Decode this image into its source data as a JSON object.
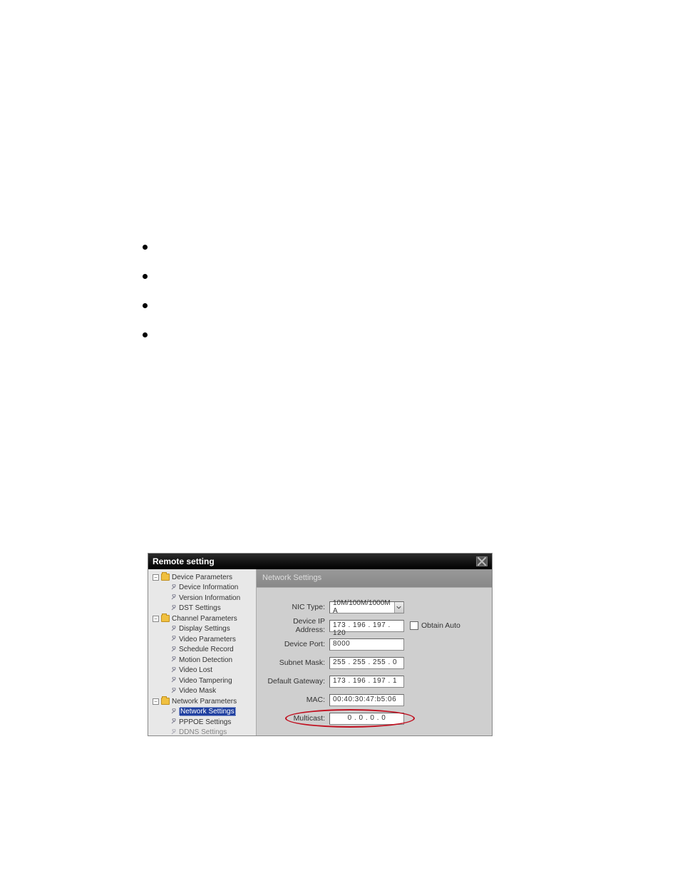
{
  "dialog": {
    "title": "Remote setting",
    "panel_header": "Network Settings"
  },
  "tree": {
    "device_params": "Device Parameters",
    "device_info": "Device Information",
    "version_info": "Version Information",
    "dst": "DST Settings",
    "channel_params": "Channel Parameters",
    "display": "Display Settings",
    "video_params": "Video Parameters",
    "schedule": "Schedule Record",
    "motion": "Motion Detection",
    "video_lost": "Video Lost",
    "video_tamper": "Video Tampering",
    "video_mask": "Video Mask",
    "network_params": "Network Parameters",
    "network_settings": "Network Settings",
    "pppoe": "PPPOE Settings",
    "ddns": "DDNS Settings"
  },
  "form": {
    "nic_type_label": "NIC Type:",
    "nic_type_value": "10M/100M/1000M A",
    "ip_label": "Device IP Address:",
    "ip_value": "173 . 196 . 197 . 120",
    "obtain_auto": "Obtain Auto",
    "port_label": "Device Port:",
    "port_value": "8000",
    "mask_label": "Subnet Mask:",
    "mask_value": "255 . 255 . 255 .   0",
    "gateway_label": "Default Gateway:",
    "gateway_value": "173 . 196 . 197 .   1",
    "mac_label": "MAC:",
    "mac_value": "00:40:30:47:b5:06",
    "multicast_label": "Multicast:",
    "multicast_value": "  0  .   0  .   0  .   0"
  }
}
